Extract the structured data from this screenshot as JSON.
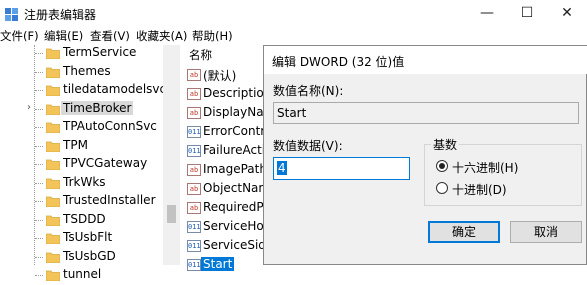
{
  "window": {
    "title": "注册表编辑器",
    "controls": {
      "minimize": "—",
      "maximize": "☐",
      "close": "✕"
    }
  },
  "menu": [
    "文件(F)",
    "编辑(E)",
    "查看(V)",
    "收藏夹(A)",
    "帮助(H)"
  ],
  "tree": {
    "items": [
      {
        "label": "TermService"
      },
      {
        "label": "Themes"
      },
      {
        "label": "tiledatamodelsvc"
      },
      {
        "label": "TimeBroker",
        "selected": true,
        "expandable": true
      },
      {
        "label": "TPAutoConnSvc"
      },
      {
        "label": "TPM"
      },
      {
        "label": "TPVCGateway"
      },
      {
        "label": "TrkWks"
      },
      {
        "label": "TrustedInstaller"
      },
      {
        "label": "TSDDD"
      },
      {
        "label": "TsUsbFlt"
      },
      {
        "label": "TsUsbGD"
      },
      {
        "label": "tunnel"
      }
    ]
  },
  "list": {
    "header": "名称",
    "items": [
      {
        "label": "(默认)",
        "type": "string"
      },
      {
        "label": "Description",
        "type": "string"
      },
      {
        "label": "DisplayNam",
        "type": "string"
      },
      {
        "label": "ErrorContro",
        "type": "binary"
      },
      {
        "label": "FailureAction",
        "type": "binary"
      },
      {
        "label": "ImagePath",
        "type": "string"
      },
      {
        "label": "ObjectName",
        "type": "string"
      },
      {
        "label": "RequiredPriv",
        "type": "string"
      },
      {
        "label": "ServiceHostS",
        "type": "binary"
      },
      {
        "label": "ServiceSidTy",
        "type": "binary"
      },
      {
        "label": "Start",
        "type": "binary",
        "selected": true
      }
    ]
  },
  "dialog": {
    "title": "编辑 DWORD (32 位)值",
    "value_name_label": "数值名称(N):",
    "value_name": "Start",
    "value_data_label": "数值数据(V):",
    "value_data": "4",
    "base_label": "基数",
    "radio_hex": "十六进制(H)",
    "radio_dec": "十进制(D)",
    "hex_selected": true,
    "ok": "确定",
    "cancel": "取消"
  },
  "icon_glyphs": {
    "string": "ab",
    "binary": "011"
  },
  "colors": {
    "selection": "#0078d7"
  }
}
